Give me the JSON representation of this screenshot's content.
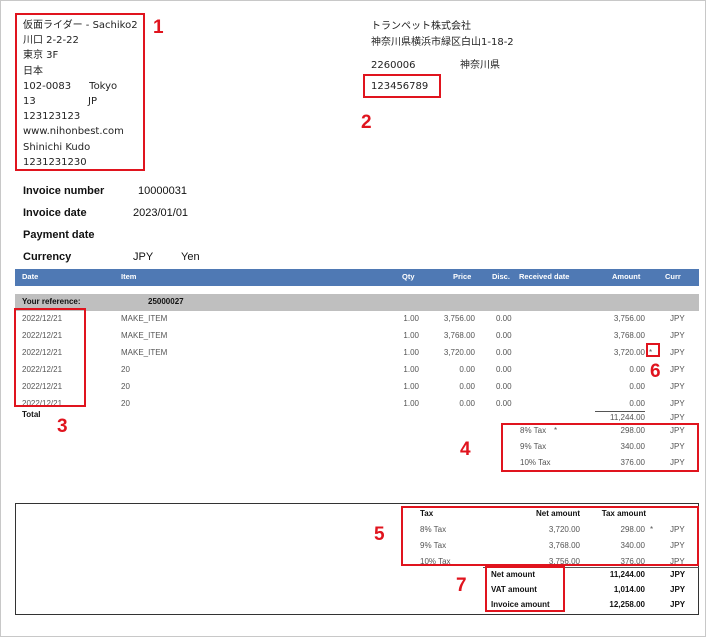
{
  "customer": {
    "lines": [
      "仮面ライダー - Sachiko2",
      "川口 2-2-22",
      "東京 3F",
      "日本"
    ],
    "postal": "102-0083",
    "city": "Tokyo",
    "num": "13",
    "country": "JP",
    "phone": "123123123",
    "web": "www.nihonbest.com",
    "contact": "Shinichi Kudo",
    "fax": "1231231230"
  },
  "company": {
    "name": "トランペット株式会社",
    "address": "神奈川県横浜市緑区白山1-18-2",
    "postal": "2260006",
    "pref": "神奈川県",
    "vat": "123456789"
  },
  "callouts": [
    "1",
    "2",
    "3",
    "4",
    "5",
    "6",
    "7"
  ],
  "invoice": {
    "number_label": "Invoice number",
    "number": "10000031",
    "date_label": "Invoice date",
    "date": "2023/01/01",
    "payment_label": "Payment date",
    "currency_label": "Currency",
    "currency_code": "JPY",
    "currency_name": "Yen"
  },
  "columns": {
    "date": "Date",
    "item": "Item",
    "qty": "Qty",
    "price": "Price",
    "disc": "Disc.",
    "received": "Received date",
    "amount": "Amount",
    "curr": "Curr"
  },
  "reference": {
    "label": "Your reference:",
    "value": "25000027"
  },
  "rows": [
    {
      "date": "2022/12/21",
      "item": "MAKE_ITEM",
      "qty": "1.00",
      "price": "3,756.00",
      "disc": "0.00",
      "amount": "3,756.00",
      "mark": "",
      "curr": "JPY"
    },
    {
      "date": "2022/12/21",
      "item": "MAKE_ITEM",
      "qty": "1.00",
      "price": "3,768.00",
      "disc": "0.00",
      "amount": "3,768.00",
      "mark": "",
      "curr": "JPY"
    },
    {
      "date": "2022/12/21",
      "item": "MAKE_ITEM",
      "qty": "1.00",
      "price": "3,720.00",
      "disc": "0.00",
      "amount": "3,720.00",
      "mark": "*",
      "curr": "JPY"
    },
    {
      "date": "2022/12/21",
      "item": "20",
      "qty": "1.00",
      "price": "0.00",
      "disc": "0.00",
      "amount": "0.00",
      "mark": "",
      "curr": "JPY"
    },
    {
      "date": "2022/12/21",
      "item": "20",
      "qty": "1.00",
      "price": "0.00",
      "disc": "0.00",
      "amount": "0.00",
      "mark": "",
      "curr": "JPY"
    },
    {
      "date": "2022/12/21",
      "item": "20",
      "qty": "1.00",
      "price": "0.00",
      "disc": "0.00",
      "amount": "0.00",
      "mark": "",
      "curr": "JPY"
    }
  ],
  "total": {
    "label": "Total",
    "amount": "11,244.00",
    "curr": "JPY"
  },
  "tax_lines": [
    {
      "label": "8% Tax",
      "mark": "*",
      "amount": "298.00",
      "curr": "JPY"
    },
    {
      "label": "9% Tax",
      "mark": "",
      "amount": "340.00",
      "curr": "JPY"
    },
    {
      "label": "10% Tax",
      "mark": "",
      "amount": "376.00",
      "curr": "JPY"
    }
  ],
  "summary": {
    "headers": {
      "tax": "Tax",
      "net": "Net amount",
      "taxamt": "Tax amount"
    },
    "rows": [
      {
        "label": "8% Tax",
        "net": "3,720.00",
        "tax": "298.00",
        "mark": "*",
        "curr": "JPY"
      },
      {
        "label": "9% Tax",
        "net": "3,768.00",
        "tax": "340.00",
        "mark": "",
        "curr": "JPY"
      },
      {
        "label": "10% Tax",
        "net": "3,756.00",
        "tax": "376.00",
        "mark": "",
        "curr": "JPY"
      }
    ],
    "totals": [
      {
        "label": "Net amount",
        "value": "11,244.00",
        "curr": "JPY"
      },
      {
        "label": "VAT amount",
        "value": "1,014.00",
        "curr": "JPY"
      },
      {
        "label": "Invoice amount",
        "value": "12,258.00",
        "curr": "JPY"
      }
    ]
  },
  "colors": {
    "accent_red": "#e0141e",
    "header_blue": "#4f79b4",
    "ref_gray": "#bfbfbf"
  }
}
